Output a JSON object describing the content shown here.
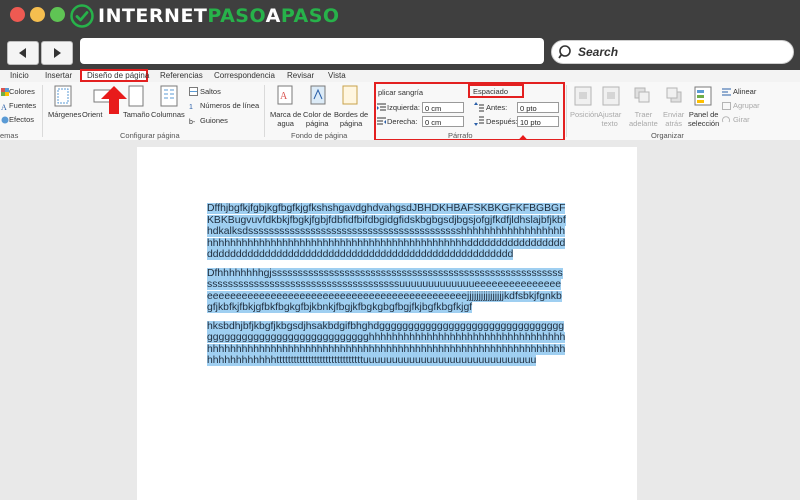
{
  "brand": {
    "part1": "INTERNET",
    "part2": "PASO",
    "part3": "A",
    "part4": "PASO",
    "color_green": "#27b24a"
  },
  "window": {
    "traffic_lights": [
      "#ee5a52",
      "#f5be4f",
      "#5fc454"
    ]
  },
  "search": {
    "label": "Search"
  },
  "tabs": [
    {
      "label": "Inicio"
    },
    {
      "label": "Insertar"
    },
    {
      "label": "Diseño de página"
    },
    {
      "label": "Referencias"
    },
    {
      "label": "Correspondencia"
    },
    {
      "label": "Revisar"
    },
    {
      "label": "Vista"
    }
  ],
  "ribbon": {
    "temas": {
      "colores": "Colores",
      "fuentes": "Fuentes",
      "efectos": "Efectos",
      "group": "emas"
    },
    "configurar": {
      "margenes": "Márgenes",
      "orientacion": "Orient",
      "tamano": "Tamaño",
      "columnas": "Columnas",
      "saltos": "Saltos",
      "numeros": "Números de línea",
      "guiones": "Guiones",
      "group": "Configurar página"
    },
    "fondo": {
      "marca_line1": "Marca de",
      "marca_line2": "agua",
      "color_line1": "Color de",
      "color_line2": "página",
      "bordes_line1": "Bordes de",
      "bordes_line2": "página",
      "group": "Fondo de página"
    },
    "parrafo": {
      "aplicar": "plicar sangría",
      "izquierda_label": "Izquierda:",
      "izquierda_value": "0 cm",
      "derecha_label": "Derecha:",
      "derecha_value": "0 cm",
      "espaciado": "Espaciado",
      "antes_label": "Antes:",
      "antes_value": "0 pto",
      "despues_label": "Después:",
      "despues_value": "10 pto",
      "group": "Párrafo"
    },
    "organizar": {
      "posicion": "Posición",
      "ajustar_line1": "Ajustar",
      "ajustar_line2": "texto",
      "traer_line1": "Traer",
      "traer_line2": "adelante",
      "enviar_line1": "Enviar",
      "enviar_line2": "atrás",
      "panel_line1": "Panel de",
      "panel_line2": "selección",
      "alinear": "Alinear",
      "agrupar": "Agrupar",
      "girar": "Girar",
      "group": "Organizar"
    }
  },
  "document": {
    "paragraphs": [
      "DffhjbgfkjfgbjkgfbgfkjgfkshshgavdghdvahgsdJBHDKHBAFSKBKGFKFBGBGFKBKBugvuvfdkbkjfbgkjfgbjfdbfidfbifdbgidgfidskbgbgsdjbgsjofgjfkdfjldhslajbfjkbfhdkalksdssssssssssssssssssssssssssssssssssssssssshhhhhhhhhhhhhhhhhhhhhhhhhhhhhhhhhhhhhhhhhhhhhhhhhhhhhhhhhhhhhhhdddddddddddddddddddddddddddddddddddddddddddddddddddddddddddddddddddddd",
      "Dfhhhhhhhhgjsssssssssssssssssssssssssssssssssssssssssssssssssssssssssssssssssssssssssssssssssssssssssssssuuuuuuuuuuuuueeeeeeeeeeeeeeeeeeeeeeeeeeeeeeeeeeeeeeeeeeeeeeeeeeeeeeeeeeeejjjjjjjjjjjjjjjjkdfsbkjfgnkbgfjkbfkjfbkjgfbkfbgkgfbjkbnkjfbgjkfbgkgbgfbgjfkjbgfkbgfkjgf",
      "hksbdhjbfjkbgfjkbgsdjhsakbdgifbhghdgggggggggggggggggggggggggggggggggggggggggggggggggggggggggggghhhhhhhhhhhhhhhhhhhhhhhhhhhhhhhhhhhhhhhhhhhhhhhhhhhhhhhhhhhhhhhhhhhhhhhhhhhhhhhhhhhhhhhhhhhhhhhhhhhhhhhhhhhhttttttttttttttttttttttttttttttuuuuuuuuuuuuuuuuuuuuuuuuuuuuuu"
    ],
    "highlight_color": "#9fcff1"
  }
}
